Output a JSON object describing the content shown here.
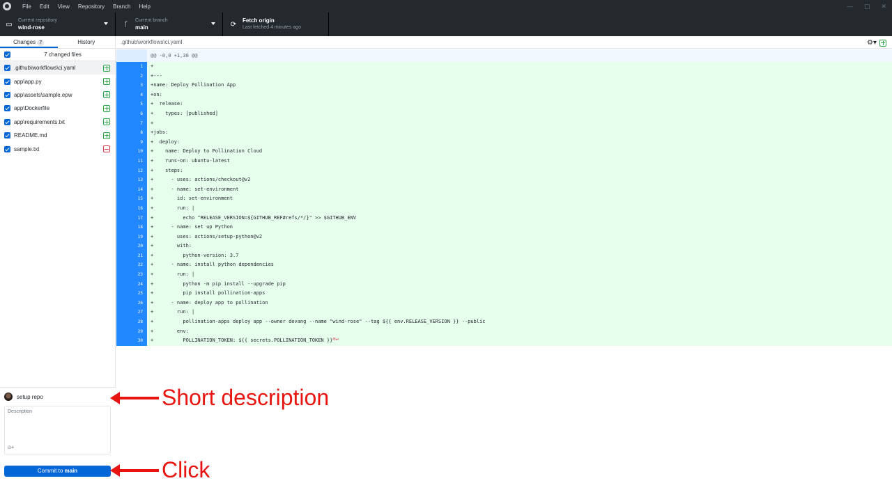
{
  "menu": [
    "File",
    "Edit",
    "View",
    "Repository",
    "Branch",
    "Help"
  ],
  "window_controls": {
    "minimize": "—",
    "maximize": "▢",
    "close": "✕"
  },
  "toolbar": {
    "repo_label": "Current repository",
    "repo_value": "wind-rose",
    "branch_label": "Current branch",
    "branch_value": "main",
    "fetch_label": "Fetch origin",
    "fetch_sub": "Last fetched 4 minutes ago"
  },
  "tabs": {
    "changes": "Changes",
    "changes_count": "7",
    "history": "History"
  },
  "files_header": "7 changed files",
  "files": [
    {
      "name": ".github\\workflows\\ci.yaml",
      "status": "added"
    },
    {
      "name": "app\\app.py",
      "status": "added"
    },
    {
      "name": "app\\assets\\sample.epw",
      "status": "added"
    },
    {
      "name": "app\\Dockerfile",
      "status": "added"
    },
    {
      "name": "app\\requirements.txt",
      "status": "added"
    },
    {
      "name": "README.md",
      "status": "added"
    },
    {
      "name": "sample.txt",
      "status": "deleted"
    }
  ],
  "commit": {
    "summary_value": "setup repo",
    "description_placeholder": "Description",
    "button_prefix": "Commit to ",
    "button_branch": "main"
  },
  "diff": {
    "path": ".github\\workflows\\ci.yaml",
    "hunk": "@@ -0,0 +1,30 @@",
    "lines": [
      "+",
      "+---",
      "+name: Deploy Pollination App",
      "+on:",
      "+  release:",
      "+    types: [published]",
      "+",
      "+jobs:",
      "+  deploy:",
      "+    name: Deploy to Pollination Cloud",
      "+    runs-on: ubuntu-latest",
      "+    steps:",
      "+      - uses: actions/checkout@v2",
      "+      - name: set-environment",
      "+        id: set-environment",
      "+        run: |",
      "+          echo \"RELEASE_VERSION=${GITHUB_REF#refs/*/}\" >> $GITHUB_ENV",
      "+      - name: set up Python",
      "+        uses: actions/setup-python@v2",
      "+        with:",
      "+          python-version: 3.7",
      "+      - name: install python dependencies",
      "+        run: |",
      "+          python -m pip install --upgrade pip",
      "+          pip install pollination-apps",
      "+      - name: deploy app to pollination",
      "+        run: |",
      "+          pollination-apps deploy app --owner devang --name \"wind-rose\" --tag ${{ env.RELEASE_VERSION }} --public",
      "+        env:",
      "+          POLLINATION_TOKEN: ${{ secrets.POLLINATION_TOKEN }}"
    ],
    "no_newline_marker": "⊘↵"
  },
  "annotations": {
    "short_description": "Short description",
    "click": "Click"
  },
  "colors": {
    "accent": "#0366d6",
    "added": "#28a745",
    "deleted": "#d73a49",
    "annotation": "#e8140f"
  }
}
